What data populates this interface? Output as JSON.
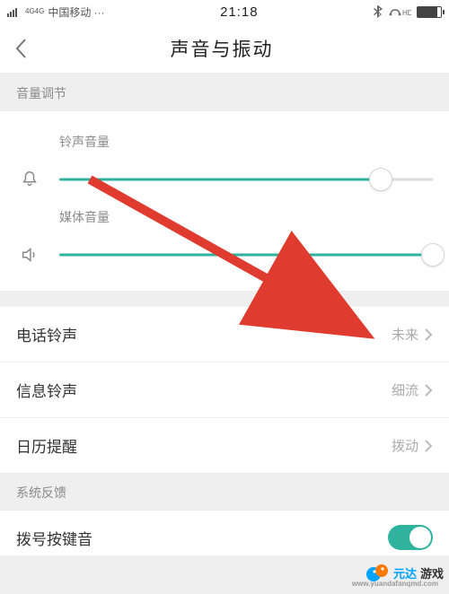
{
  "status": {
    "signal_label": "4G4G",
    "carrier": "中国移动 ···",
    "time": "21:18",
    "hd": "HD"
  },
  "nav": {
    "title": "声音与振动"
  },
  "sections": {
    "volume_header": "音量调节",
    "feedback_header": "系统反馈"
  },
  "sliders": {
    "ringtone": {
      "label": "铃声音量",
      "value": 86
    },
    "media": {
      "label": "媒体音量",
      "value": 100
    }
  },
  "rows": {
    "phone": {
      "title": "电话铃声",
      "value": "未来"
    },
    "message": {
      "title": "信息铃声",
      "value": "细流"
    },
    "calendar": {
      "title": "日历提醒",
      "value": "拨动"
    },
    "dialpad": {
      "title": "拨号按键音"
    }
  },
  "watermark": {
    "brand1": "元达",
    "brand2": "游戏",
    "url": "www.yuandafanqmd.com"
  }
}
